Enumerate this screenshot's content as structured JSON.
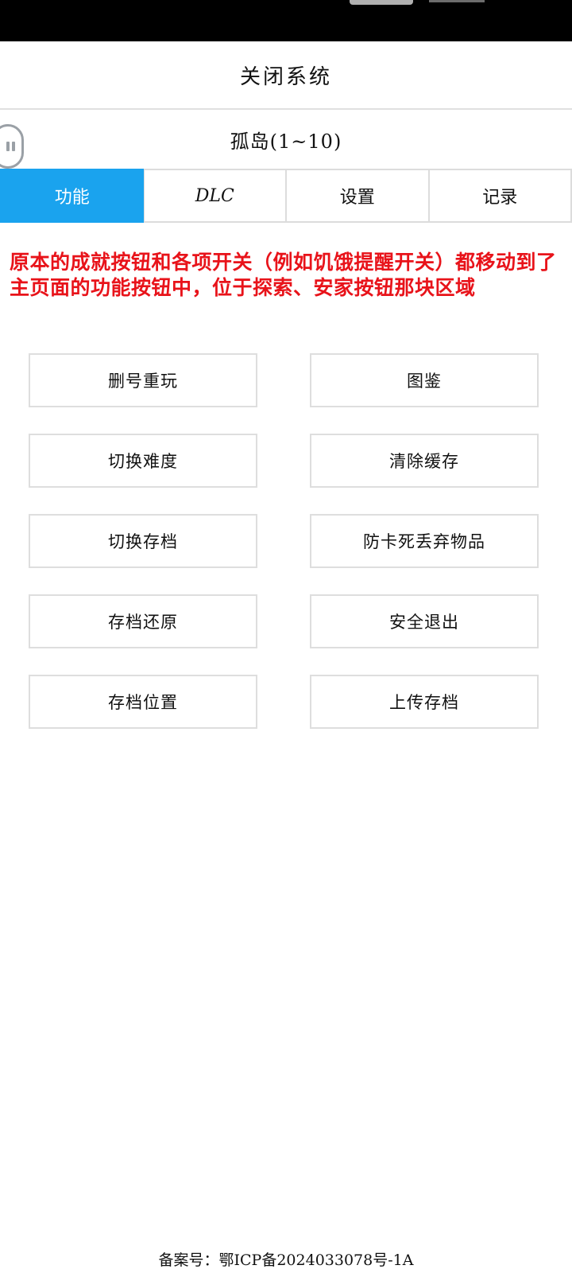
{
  "header": {
    "title": "关闭系统"
  },
  "world": {
    "name": "孤岛(1~10)"
  },
  "tabs": [
    {
      "label": "功能",
      "active": true
    },
    {
      "label": "DLC",
      "active": false
    },
    {
      "label": "设置",
      "active": false
    },
    {
      "label": "记录",
      "active": false
    }
  ],
  "notice": {
    "text": "原本的成就按钮和各项开关（例如饥饿提醒开关）都移动到了主页面的功能按钮中，位于探索、安家按钮那块区域",
    "color": "#e8131a"
  },
  "buttons": [
    {
      "label": "删号重玩"
    },
    {
      "label": "图鉴"
    },
    {
      "label": "切换难度"
    },
    {
      "label": "清除缓存"
    },
    {
      "label": "切换存档"
    },
    {
      "label": "防卡死丢弃物品"
    },
    {
      "label": "存档还原"
    },
    {
      "label": "安全退出"
    },
    {
      "label": "存档位置"
    },
    {
      "label": "上传存档"
    }
  ],
  "footer": {
    "text": "备案号：鄂ICP备2024033078号-1A"
  },
  "colors": {
    "accent": "#1aa3ee",
    "notice": "#e8131a",
    "border": "#dedede"
  }
}
